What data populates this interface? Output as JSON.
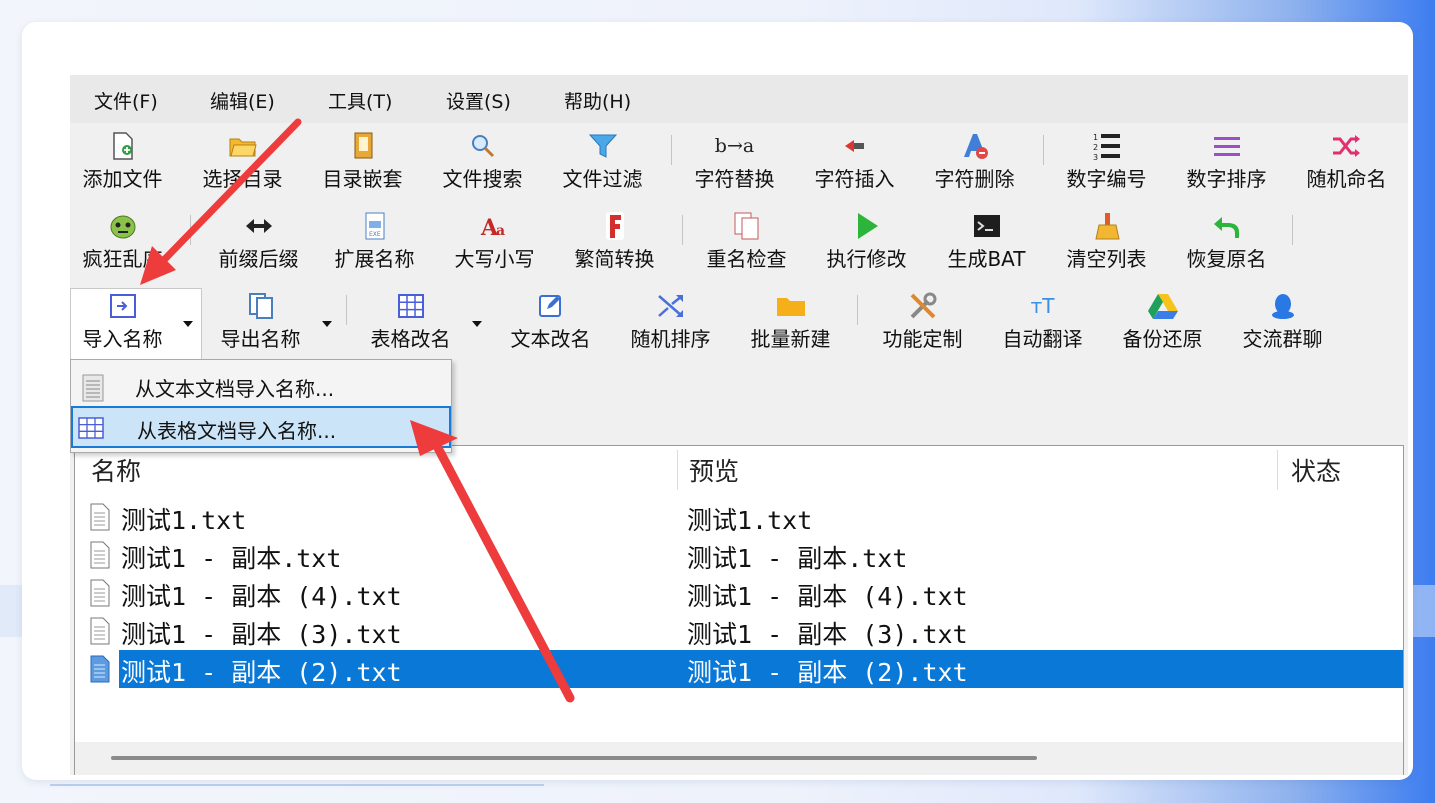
{
  "menu": [
    "文件(F)",
    "编辑(E)",
    "工具(T)",
    "设置(S)",
    "帮助(H)"
  ],
  "toolbar_row1": [
    "添加文件",
    "选择目录",
    "目录嵌套",
    "文件搜索",
    "文件过滤",
    "字符替换",
    "字符插入",
    "字符删除",
    "数字编号",
    "数字排序",
    "随机命名"
  ],
  "toolbar_row2": [
    "疯狂乱序",
    "前缀后缀",
    "扩展名称",
    "大写小写",
    "繁简转换",
    "重名检查",
    "执行修改",
    "生成BAT",
    "清空列表",
    "恢复原名"
  ],
  "toolbar_row3": [
    "导入名称",
    "导出名称",
    "表格改名",
    "文本改名",
    "随机排序",
    "批量新建",
    "功能定制",
    "自动翻译",
    "备份还原",
    "交流群聊"
  ],
  "icon_text": {
    "char_replace": "b→a",
    "auto_translate": "ᴛT"
  },
  "dropdown": {
    "items": [
      "从文本文档导入名称...",
      "从表格文档导入名称..."
    ],
    "selected_index": 1
  },
  "list": {
    "columns": [
      "名称",
      "预览",
      "状态"
    ],
    "rows": [
      {
        "name": "测试1.txt",
        "preview": "测试1.txt"
      },
      {
        "name": "测试1 - 副本.txt",
        "preview": "测试1 - 副本.txt"
      },
      {
        "name": "测试1 - 副本 (4).txt",
        "preview": "测试1 - 副本 (4).txt"
      },
      {
        "name": "测试1 - 副本 (3).txt",
        "preview": "测试1 - 副本 (3).txt"
      },
      {
        "name": "测试1 - 副本 (2).txt",
        "preview": "测试1 - 副本 (2).txt"
      }
    ],
    "selected_index": 4
  },
  "colors": {
    "accent": "#0a78d7",
    "annotation_arrow": "#ee3b3b"
  }
}
